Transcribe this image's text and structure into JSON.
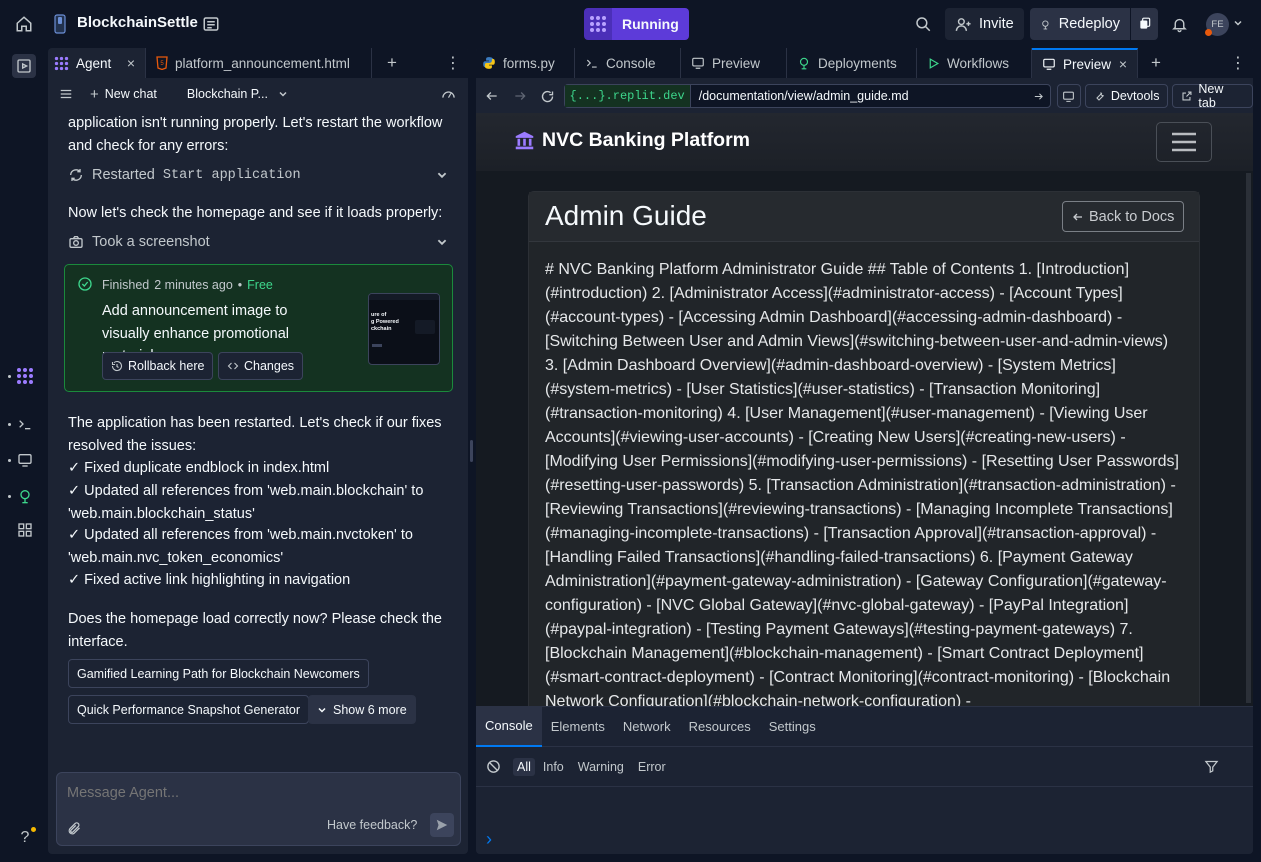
{
  "topbar": {
    "project_name": "BlockchainSettle",
    "status_label": "Running",
    "invite_label": "Invite",
    "redeploy_label": "Redeploy",
    "avatar_initials": "FE"
  },
  "left_tabs": {
    "agent": "Agent",
    "file": "platform_announcement.html"
  },
  "agent_toolbar": {
    "new_chat": "New chat",
    "project_select": "Blockchain P..."
  },
  "chat": {
    "partial_text": "application isn't running properly. Let's restart the workflow and check for any errors:",
    "restarted_prefix": "Restarted",
    "restarted_name": "Start application",
    "homepage_check": "Now let's check the homepage and see if it loads properly:",
    "screenshot_label": "Took a screenshot",
    "card": {
      "finished": "Finished",
      "time": "2 minutes ago",
      "dot": "•",
      "cost": "Free",
      "title": "Add announcement image to visually enhance promotional materials",
      "rollback": "Rollback here",
      "changes": "Changes",
      "thumb_line1": "ure of",
      "thumb_line2": "g Powered",
      "thumb_line3": "ckchain"
    },
    "restart_msg": "The application has been restarted. Let's check if our fixes resolved the issues:",
    "fixes": [
      "✓ Fixed duplicate endblock in index.html",
      "✓ Updated all references from 'web.main.blockchain' to 'web.main.blockchain_status'",
      "✓ Updated all references from 'web.main.nvctoken' to 'web.main.nvc_token_economics'",
      "✓ Fixed active link highlighting in navigation"
    ],
    "question": "Does the homepage load correctly now? Please check the interface.",
    "suggestions": [
      "Gamified Learning Path for Blockchain Newcomers",
      "Quick Performance Snapshot Generator"
    ],
    "show_more": "Show 6 more"
  },
  "composer": {
    "placeholder": "Message Agent...",
    "feedback": "Have feedback?"
  },
  "right_tabs": [
    "forms.py",
    "Console",
    "Preview",
    "Deployments",
    "Workflows",
    "Preview"
  ],
  "urlbar": {
    "domain": "{...}.replit.dev",
    "path": "/documentation/view/admin_guide.md",
    "devtools": "Devtools",
    "new_tab": "New tab"
  },
  "preview": {
    "brand": "NVC Banking Platform",
    "heading": "Admin Guide",
    "back_button": "Back to Docs",
    "body": "# NVC Banking Platform Administrator Guide ## Table of Contents 1. [Introduction](#introduction) 2. [Administrator Access](#administrator-access) - [Account Types](#account-types) - [Accessing Admin Dashboard](#accessing-admin-dashboard) - [Switching Between User and Admin Views](#switching-between-user-and-admin-views) 3. [Admin Dashboard Overview](#admin-dashboard-overview) - [System Metrics](#system-metrics) - [User Statistics](#user-statistics) - [Transaction Monitoring](#transaction-monitoring) 4. [User Management](#user-management) - [Viewing User Accounts](#viewing-user-accounts) - [Creating New Users](#creating-new-users) - [Modifying User Permissions](#modifying-user-permissions) - [Resetting User Passwords](#resetting-user-passwords) 5. [Transaction Administration](#transaction-administration) - [Reviewing Transactions](#reviewing-transactions) - [Managing Incomplete Transactions](#managing-incomplete-transactions) - [Transaction Approval](#transaction-approval) - [Handling Failed Transactions](#handling-failed-transactions) 6. [Payment Gateway Administration](#payment-gateway-administration) - [Gateway Configuration](#gateway-configuration) - [NVC Global Gateway](#nvc-global-gateway) - [PayPal Integration](#paypal-integration) - [Testing Payment Gateways](#testing-payment-gateways) 7. [Blockchain Management](#blockchain-management) - [Smart Contract Deployment](#smart-contract-deployment) - [Contract Monitoring](#contract-monitoring) - [Blockchain Network Configuration](#blockchain-network-configuration) -"
  },
  "devtools": {
    "tabs": [
      "Console",
      "Elements",
      "Network",
      "Resources",
      "Settings"
    ],
    "filters": [
      "All",
      "Info",
      "Warning",
      "Error"
    ],
    "prompt": "›"
  },
  "colors": {
    "accent": "#0079f2",
    "running": "#5d3bd9",
    "success": "#1b8a3c",
    "success_text": "#3dd68c",
    "panel": "#1c2333",
    "background": "#0e1525"
  }
}
